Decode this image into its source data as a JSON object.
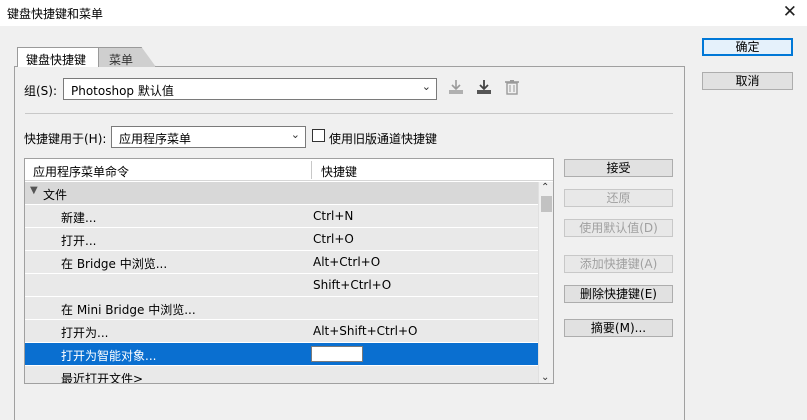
{
  "window": {
    "title": "键盘快捷键和菜单",
    "close_glyph": "✕"
  },
  "tabs": [
    {
      "label": "键盘快捷键"
    },
    {
      "label": "菜单"
    }
  ],
  "group": {
    "label": "组(S):",
    "value": "Photoshop 默认值",
    "icons": [
      "save-set-icon",
      "save-as-set-icon",
      "delete-set-icon"
    ]
  },
  "shortcuts_for": {
    "label": "快捷键用于(H):",
    "value": "应用程序菜单",
    "legacy_checkbox_label": "使用旧版通道快捷键",
    "legacy_checked": false
  },
  "table": {
    "col_command": "应用程序菜单命令",
    "col_shortcut": "快捷键",
    "rows": [
      {
        "command": "文件",
        "shortcut": "",
        "type": "group"
      },
      {
        "command": "新建...",
        "shortcut": "Ctrl+N",
        "type": "item"
      },
      {
        "command": "打开...",
        "shortcut": "Ctrl+O",
        "type": "item"
      },
      {
        "command": "在 Bridge 中浏览...",
        "shortcut": "Alt+Ctrl+O",
        "type": "item"
      },
      {
        "command": "",
        "shortcut": "Shift+Ctrl+O",
        "type": "item"
      },
      {
        "command": "在 Mini Bridge 中浏览...",
        "shortcut": "",
        "type": "item"
      },
      {
        "command": "打开为...",
        "shortcut": "Alt+Shift+Ctrl+O",
        "type": "item"
      },
      {
        "command": "打开为智能对象...",
        "shortcut": "",
        "type": "selected"
      },
      {
        "command": "最近打开文件>",
        "shortcut": "",
        "type": "item"
      }
    ]
  },
  "buttons": {
    "ok": "确定",
    "cancel": "取消",
    "accept": "接受",
    "undo": "还原",
    "use_default": "使用默认值(D)",
    "add_shortcut": "添加快捷键(A)",
    "delete_shortcut": "删除快捷键(E)",
    "summarize": "摘要(M)..."
  },
  "colors": {
    "selection": "#0a6fd0",
    "default_button_border": "#0078d7"
  }
}
